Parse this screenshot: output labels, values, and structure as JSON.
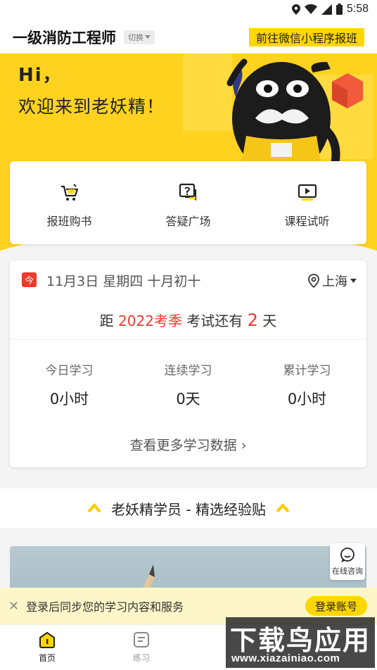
{
  "status_bar": {
    "time": "5:58"
  },
  "header": {
    "title": "一级消防工程师",
    "switch_label": "切换",
    "wechat_button": "前往微信小程序报班"
  },
  "hero": {
    "greeting": "Hi，",
    "welcome": "欢迎来到老妖精！"
  },
  "quick_actions": [
    {
      "label": "报班购书",
      "icon": "cart-icon"
    },
    {
      "label": "答疑广场",
      "icon": "question-chat-icon"
    },
    {
      "label": "课程试听",
      "icon": "video-play-icon"
    }
  ],
  "calendar": {
    "badge": "今",
    "date": "11月3日 星期四 十月初十",
    "location": "上海",
    "countdown_prefix": "距 ",
    "countdown_season": "2022考季",
    "countdown_middle": " 考试还有 ",
    "countdown_days": "2",
    "countdown_suffix": " 天"
  },
  "stats": [
    {
      "label": "今日学习",
      "value": "0小时"
    },
    {
      "label": "连续学习",
      "value": "0天"
    },
    {
      "label": "累计学习",
      "value": "0小时"
    }
  ],
  "more_link": "查看更多学习数据 ›",
  "section": {
    "title": "老妖精学员 - 精选经验贴"
  },
  "consult": {
    "label": "在线咨询"
  },
  "login_banner": {
    "text": "登录后同步您的学习内容和服务",
    "button": "登录账号",
    "close": "✕"
  },
  "tabs": [
    {
      "label": "首页",
      "icon": "home-icon",
      "active": true
    },
    {
      "label": "练习",
      "icon": "practice-icon",
      "active": false
    }
  ],
  "watermark": {
    "main": "下载鸟应用",
    "sub": "www.xiazainiao.com"
  },
  "colors": {
    "accent": "#ffd600",
    "hero": "#ffd21f",
    "red": "#f0392b"
  }
}
